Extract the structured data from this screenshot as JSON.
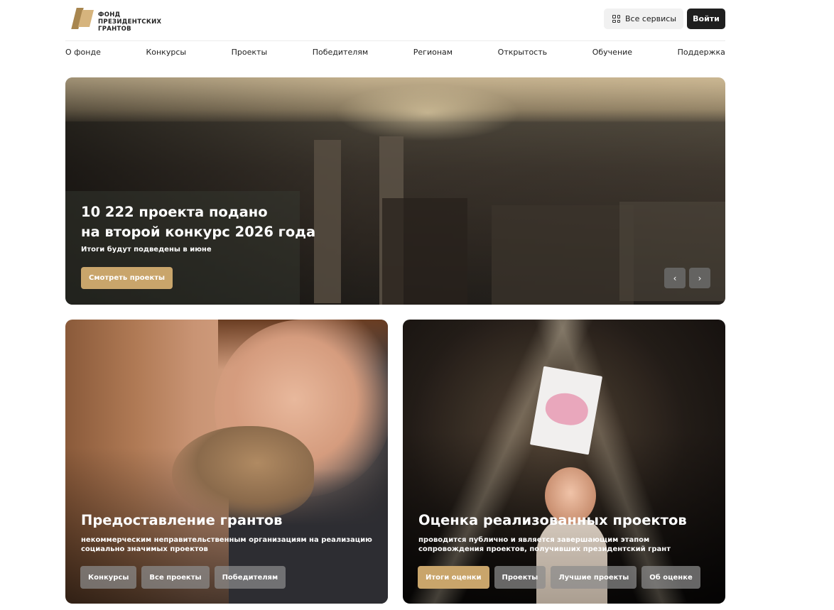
{
  "header": {
    "logo_text": "ФОНД\nПРЕЗИДЕНТСКИХ\nГРАНТОВ",
    "services_label": "Все сервисы",
    "login_label": "Войти"
  },
  "nav": {
    "items": [
      "О фонде",
      "Конкурсы",
      "Проекты",
      "Победителям",
      "Регионам",
      "Открытость",
      "Обучение",
      "Поддержка"
    ]
  },
  "hero": {
    "title_line1": "10 222 проекта подано",
    "title_line2": "на второй конкурс 2026 года",
    "subtitle": "Итоги будут подведены в июне",
    "cta_label": "Смотреть проекты",
    "prev_icon": "‹",
    "next_icon": "›"
  },
  "cards": {
    "left": {
      "title": "Предоставление грантов",
      "description": "некоммерческим неправительственным организациям на реализацию социально значимых проектов",
      "buttons": [
        "Конкурсы",
        "Все проекты",
        "Победителям"
      ]
    },
    "right": {
      "title": "Оценка реализованных проектов",
      "description": "проводится публично и является завершающим этапом сопровождения проектов, получивших президентский грант",
      "buttons": [
        "Итоги оценки",
        "Проекты",
        "Лучшие проекты",
        "Об оценке"
      ]
    }
  },
  "colors": {
    "accent": "#c9a56b",
    "dark": "#1f1f1f"
  }
}
